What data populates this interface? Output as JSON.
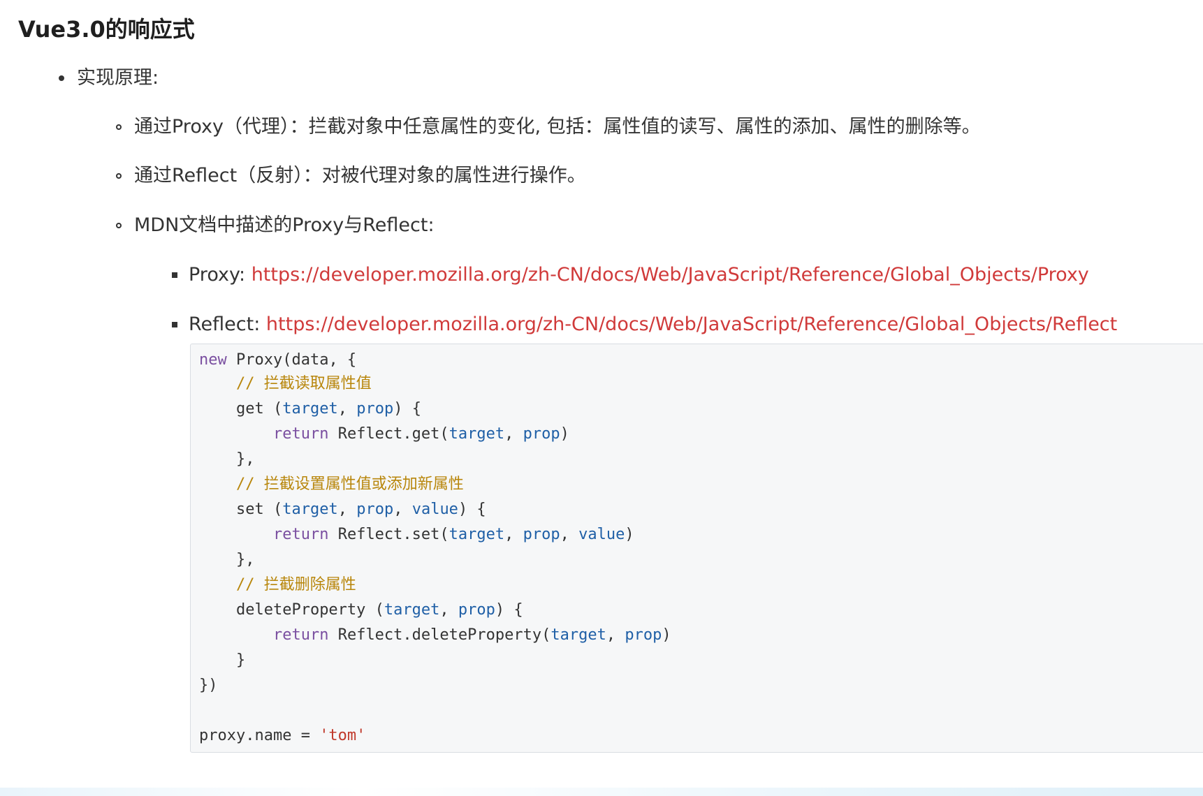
{
  "page": {
    "title": "Vue3.0的响应式"
  },
  "list": {
    "l1": "实现原理:",
    "l2": [
      "通过Proxy（代理）：拦截对象中任意属性的变化, 包括：属性值的读写、属性的添加、属性的删除等。",
      "通过Reflect（反射）：对被代理对象的属性进行操作。",
      "MDN文档中描述的Proxy与Reflect:"
    ],
    "l3": [
      {
        "label": "Proxy:",
        "url": "https://developer.mozilla.org/zh-CN/docs/Web/JavaScript/Reference/Global_Objects/Proxy"
      },
      {
        "label": "Reflect:",
        "url": "https://developer.mozilla.org/zh-CN/docs/Web/JavaScript/Reference/Global_Objects/Reflect"
      }
    ]
  },
  "code": {
    "new_kw": "new",
    "line1_rest": " Proxy(data, {",
    "comment1": "// 拦截读取属性值",
    "get_name": "get",
    "target": "target",
    "prop": "prop",
    "value": "value",
    "return_kw": "return",
    "reflect_get": "Reflect.get(",
    "close_brace_comma": "},",
    "comment2": "// 拦截设置属性值或添加新属性",
    "set_name": "set",
    "reflect_set": "Reflect.set(",
    "comment3": "// 拦截删除属性",
    "delete_name": "deleteProperty",
    "reflect_delete": "Reflect.deleteProperty(",
    "close_brace": "}",
    "end": "})",
    "last_line_code": "proxy.name = ",
    "last_line_str": "'tom'"
  },
  "colors": {
    "link": "#d03a3a",
    "keyword": "#7a4fa0",
    "param": "#1f5fa6",
    "comment": "#b8860b",
    "string": "#c0392b",
    "code_bg": "#f6f7f8"
  }
}
